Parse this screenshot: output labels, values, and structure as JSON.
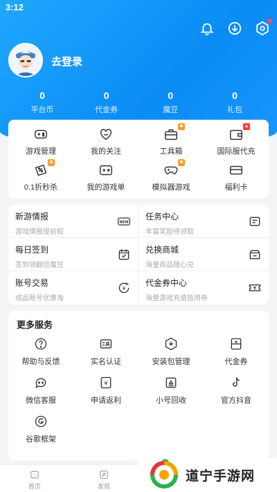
{
  "status": {
    "time": "3:12"
  },
  "top_icons": [
    "bell-icon",
    "download-icon",
    "settings-icon"
  ],
  "profile": {
    "login_text": "去登录"
  },
  "stats": [
    {
      "value": "0",
      "label": "平台币"
    },
    {
      "value": "0",
      "label": "代金券"
    },
    {
      "value": "0",
      "label": "魔豆"
    },
    {
      "value": "0",
      "label": "礼包"
    }
  ],
  "quick_items": [
    {
      "label": "游戏管理",
      "icon": "gamepad-icon"
    },
    {
      "label": "我的关注",
      "icon": "heart-icon"
    },
    {
      "label": "工具箱",
      "icon": "toolbox-icon"
    },
    {
      "label": "国际服代充",
      "icon": "wallet-icon"
    },
    {
      "label": "0.1折秒杀",
      "icon": "discount-icon"
    },
    {
      "label": "我的游戏单",
      "icon": "game-list-icon"
    },
    {
      "label": "模拟器游戏",
      "icon": "emulator-icon"
    },
    {
      "label": "福利卡",
      "icon": "card-icon"
    }
  ],
  "info_items": [
    {
      "title": "新游情报",
      "sub": "游戏情报提前知",
      "icon": "new-icon"
    },
    {
      "title": "任务中心",
      "sub": "丰富奖励待领取",
      "icon": "task-icon"
    },
    {
      "title": "每日签到",
      "sub": "签到领翻倍魔豆",
      "icon": "calendar-icon"
    },
    {
      "title": "兑换商城",
      "sub": "海量商品随心兑",
      "icon": "shop-icon"
    },
    {
      "title": "账号交易",
      "sub": "成品账号优惠淘",
      "icon": "yen-exchange-icon"
    },
    {
      "title": "代金券中心",
      "sub": "海量游戏充值抵用券",
      "icon": "coupon-icon"
    }
  ],
  "more_services": {
    "title": "更多服务",
    "items": [
      {
        "label": "帮助与反馈",
        "icon": "help-icon"
      },
      {
        "label": "实名认证",
        "icon": "id-card-icon"
      },
      {
        "label": "安装包管理",
        "icon": "package-icon"
      },
      {
        "label": "代金券",
        "icon": "voucher-icon"
      },
      {
        "label": "微信客服",
        "icon": "chat-icon"
      },
      {
        "label": "申请返利",
        "icon": "rebate-icon"
      },
      {
        "label": "小号回收",
        "icon": "recycle-icon"
      },
      {
        "label": "官方抖音",
        "icon": "tiktok-icon"
      },
      {
        "label": "谷歌框架",
        "icon": "google-icon"
      }
    ]
  },
  "bottom_nav": [
    {
      "label": "首页",
      "icon": "home-icon"
    },
    {
      "label": "发现",
      "icon": "discover-icon"
    }
  ],
  "watermark": {
    "text": "道宁手游网"
  },
  "colors": {
    "primary": "#0a8cf5",
    "badge_orange": "#ff9b2b",
    "badge_red": "#ff3b30"
  }
}
